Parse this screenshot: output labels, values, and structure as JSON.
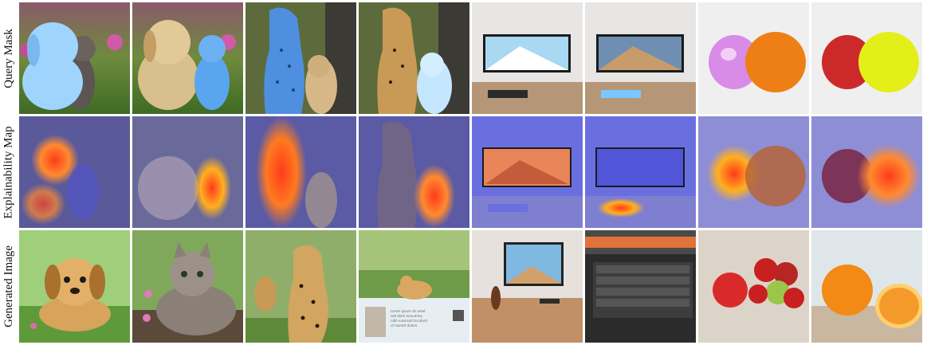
{
  "rows": [
    {
      "label": "Query Mask"
    },
    {
      "label": "Explainability Map"
    },
    {
      "label": "Generated Image"
    }
  ],
  "generated_caption_lines": [
    "Lorem ipsum sit amet",
    "sed diam nonummy",
    "nibh euismod tincidunt",
    "ut laoreet dolore"
  ],
  "colors": {
    "mask": "#7cc3ff",
    "heat_hot": "#ff3b1a",
    "heat_warm": "#ffb020",
    "heat_cool": "#4b4fd6",
    "background": "#ffffff"
  }
}
